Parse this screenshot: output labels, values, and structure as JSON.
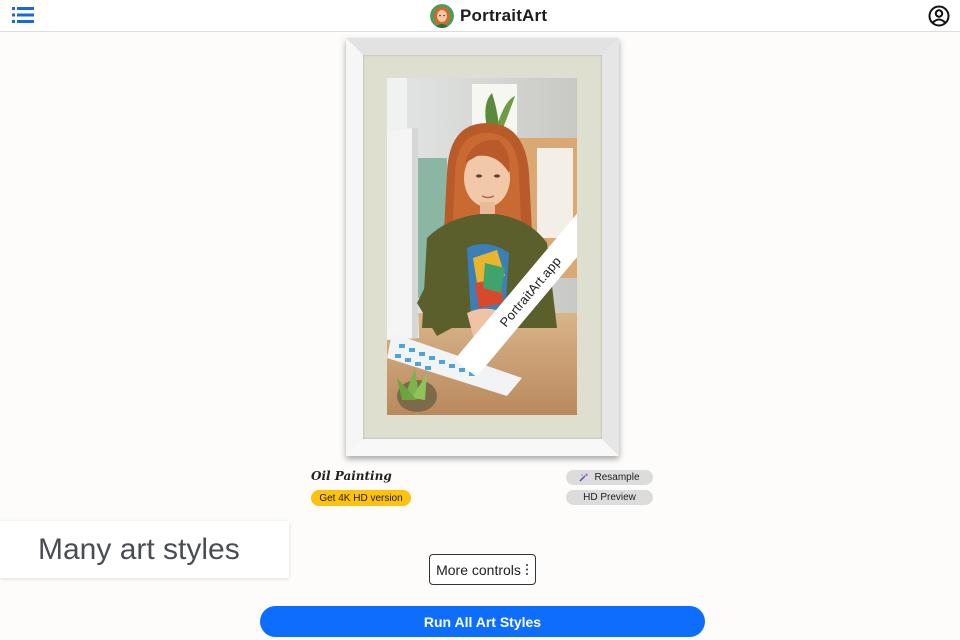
{
  "header": {
    "brand_name": "PortraitArt",
    "menu_icon": "list-icon",
    "account_icon": "user-circle-icon",
    "logo_icon": "portrait-avatar-logo"
  },
  "preview": {
    "watermark": "PortraitArt.app",
    "style_name": "Oil Painting",
    "hd_button_label": "Get 4K HD version",
    "resample_label": "Resample",
    "resample_icon": "wand-icon",
    "hd_preview_label": "HD Preview"
  },
  "promo": {
    "text": "Many art styles"
  },
  "controls": {
    "more_controls_label": "More controls",
    "more_controls_icon": "kebab-vertical-icon",
    "run_all_label": "Run All Art Styles"
  },
  "colors": {
    "accent_blue": "#0d6efd",
    "hd_yellow": "#fcc20d",
    "pill_gray": "#dcdcdc",
    "promo_text": "#4a4e54"
  }
}
